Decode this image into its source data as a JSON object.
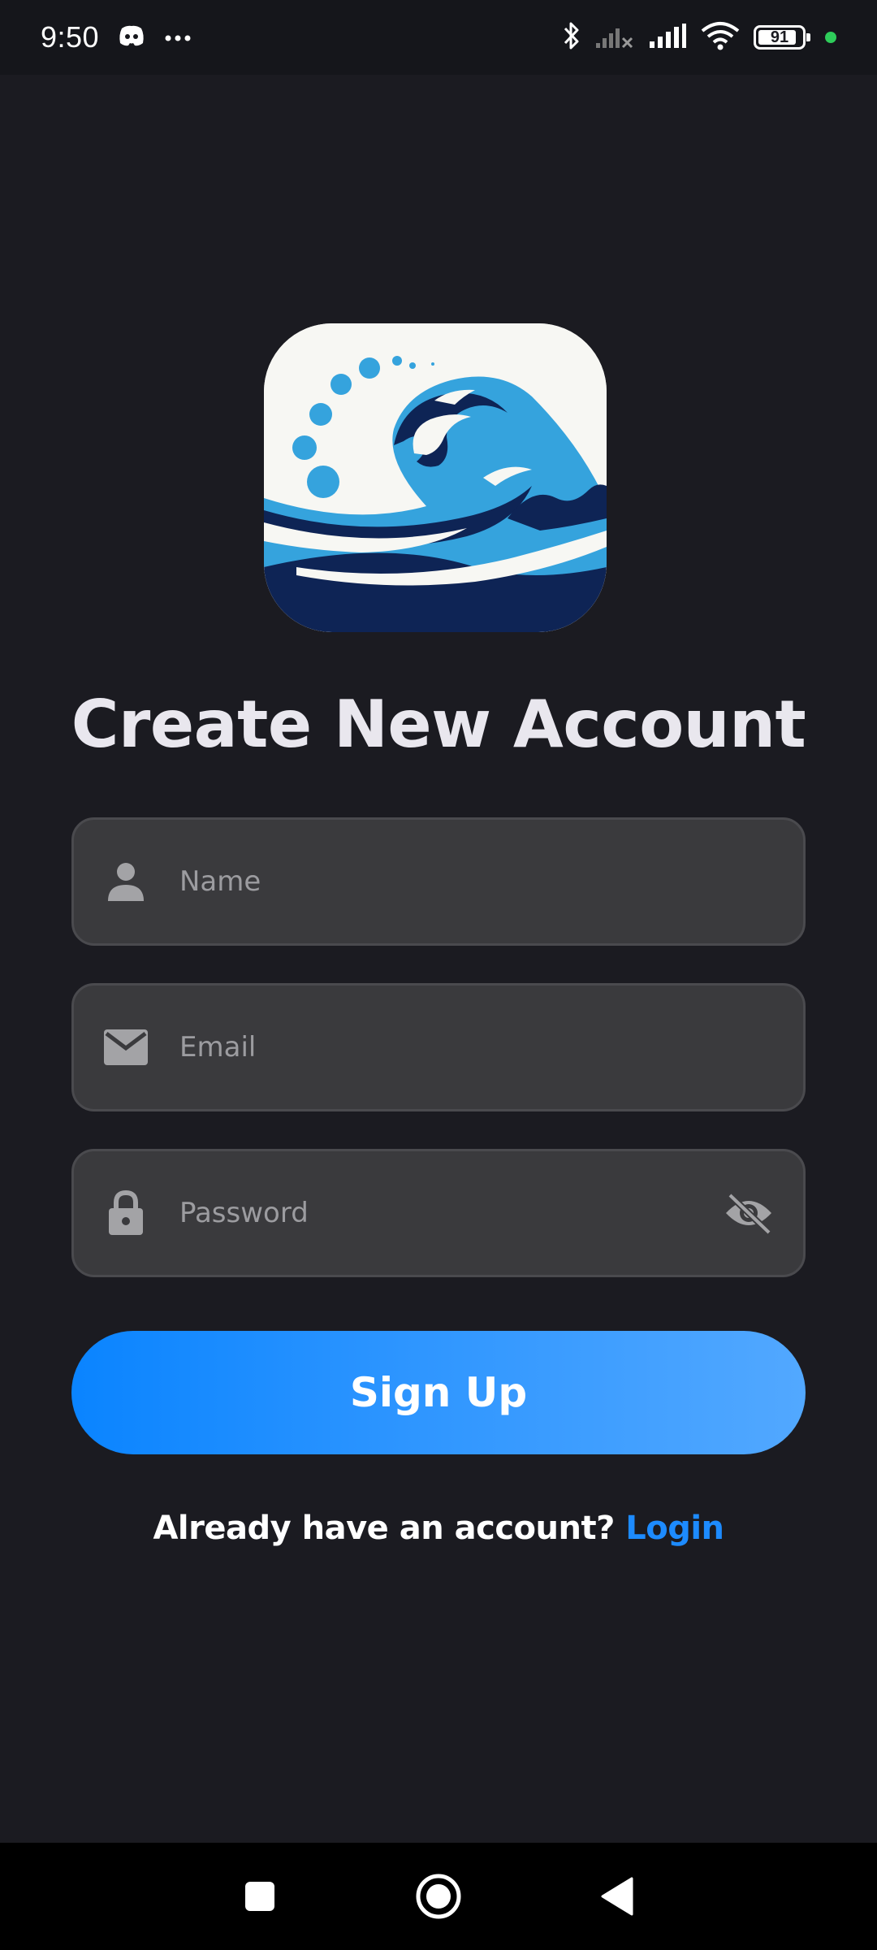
{
  "status_bar": {
    "time": "9:50",
    "battery": "91",
    "icons": [
      "discord-icon",
      "more-dots-icon",
      "bluetooth-icon",
      "signal-off-icon",
      "signal-icon",
      "wifi-icon",
      "battery-icon",
      "privacy-dot-icon"
    ],
    "battery_level": 0.91
  },
  "logo": {
    "icon": "wave-logo-icon"
  },
  "title": "Create New Account",
  "form": {
    "name": {
      "placeholder": "Name",
      "value": "",
      "icon": "person-icon"
    },
    "email": {
      "placeholder": "Email",
      "value": "",
      "icon": "mail-icon"
    },
    "password": {
      "placeholder": "Password",
      "value": "",
      "icon": "lock-icon",
      "toggle_icon": "eye-off-icon"
    }
  },
  "signup_label": "Sign Up",
  "login_prompt": "Already have an account?",
  "login_link": "Login",
  "colors": {
    "background": "#1b1b21",
    "accent": "#0a84ff",
    "link": "#1d8bff",
    "field_bg": "#3a3a3d"
  },
  "nav": {
    "icons": [
      "recents-square-icon",
      "home-circle-icon",
      "back-triangle-icon"
    ]
  }
}
